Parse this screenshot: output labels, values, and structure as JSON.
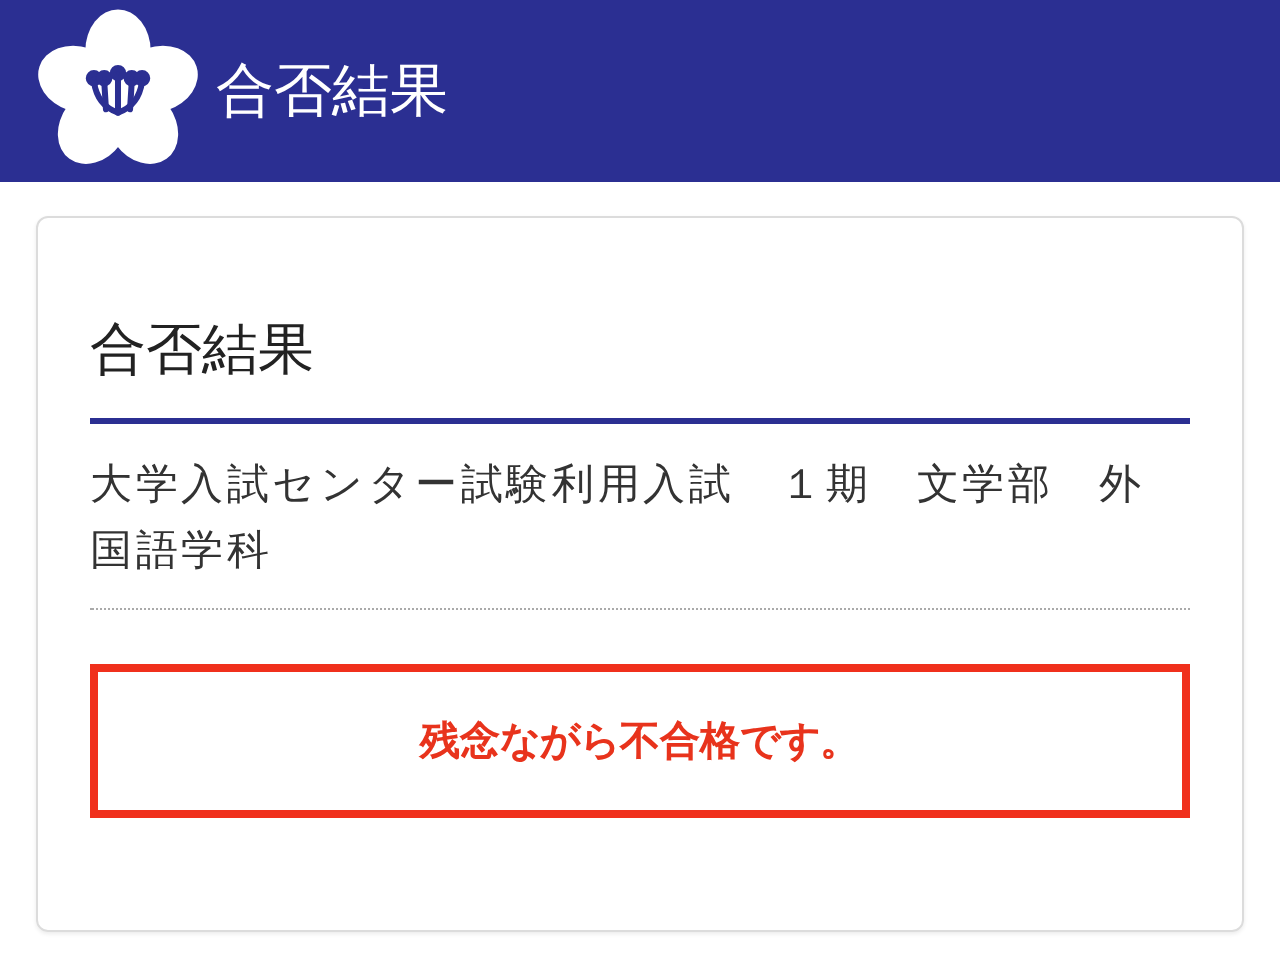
{
  "header": {
    "title": "合否結果"
  },
  "card": {
    "title": "合否結果",
    "exam": "大学入試センター試験利用入試　１期　文学部　外国語学科",
    "result": {
      "kind": "fail",
      "text": "残念ながら不合格です。"
    }
  }
}
